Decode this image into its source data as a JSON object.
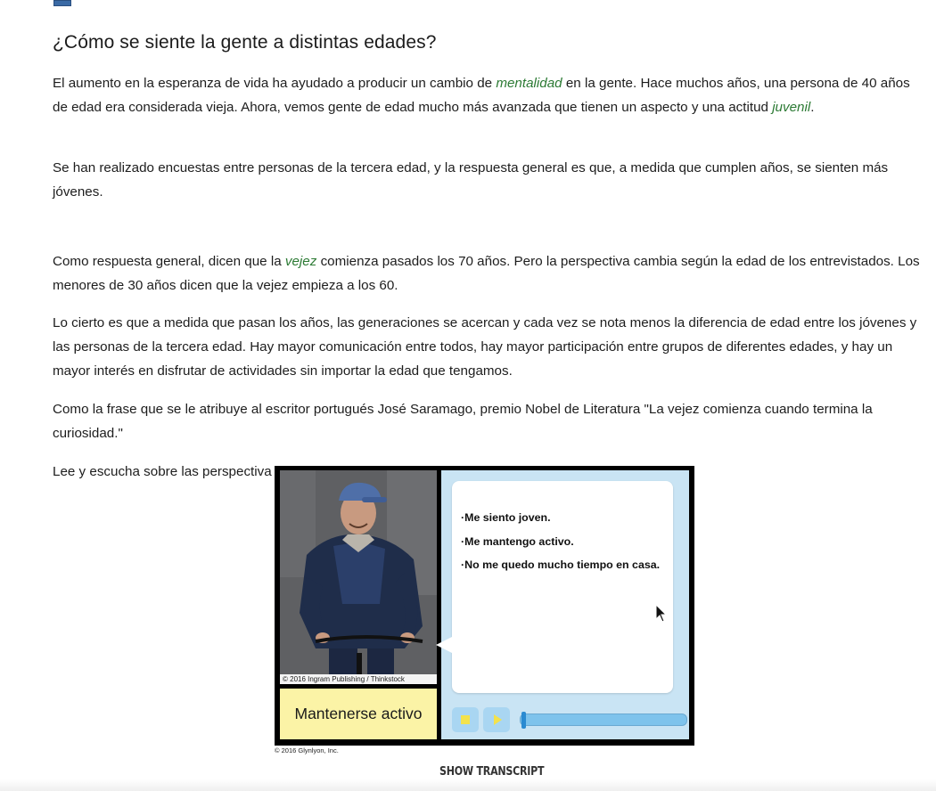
{
  "article": {
    "heading": "¿Cómo se siente la gente a distintas edades?",
    "p1": {
      "a": "El aumento en la esperanza de vida ha ayudado a producir un cambio de ",
      "vocab1": "mentalidad",
      "b": " en la gente. Hace muchos años, una persona de 40 años de edad era considerada vieja. Ahora, vemos gente de edad mucho más avanzada que tienen un aspecto y una actitud ",
      "vocab2": "juvenil",
      "c": "."
    },
    "p2": "Se han realizado encuestas entre personas de la tercera edad, y la respuesta general es que, a medida que cumplen años, se sienten más jóvenes.",
    "p3": {
      "a": "Como respuesta general, dicen que la ",
      "vocab": "vejez",
      "b": " comienza pasados los 70 años. Pero la perspectiva cambia según la edad de los entrevistados. Los menores de 30 años dicen que la vejez empieza a los 60."
    },
    "p4": "Lo cierto es que a medida que pasan los años, las generaciones se acercan y cada vez se nota menos la diferencia de edad entre los jóvenes y las personas de la tercera edad. Hay mayor comunicación entre todos, hay mayor participación entre grupos de diferentes edades, y hay un mayor interés en disfrutar de actividades sin importar la edad que tengamos.",
    "p5": "Como la frase que se le atribuye al escritor portugués José Saramago, premio Nobel de Literatura \"La vejez comienza cuando termina la curiosidad.\"",
    "p6": "Lee y escucha sobre las perspectiva que tienen los hispanohablantes sobre la vejez."
  },
  "media": {
    "photo_credit": "© 2016 Ingram Publishing / Thinkstock",
    "word": "Mantenerse activo",
    "bullets": [
      "·Me siento joven.",
      "·Me mantengo activo.",
      "·No me quedo mucho tiempo en casa."
    ],
    "progress_fraction": 0.0,
    "copyright": "© 2016 Glynlyon, Inc."
  },
  "transcript_button": "SHOW TRANSCRIPT",
  "colors": {
    "vocab": "#2c7a34",
    "word_box": "#fbf3a6",
    "panel": "#c9e4f4",
    "controls": "#a9d6f2",
    "control_glyph": "#f3e24c"
  }
}
